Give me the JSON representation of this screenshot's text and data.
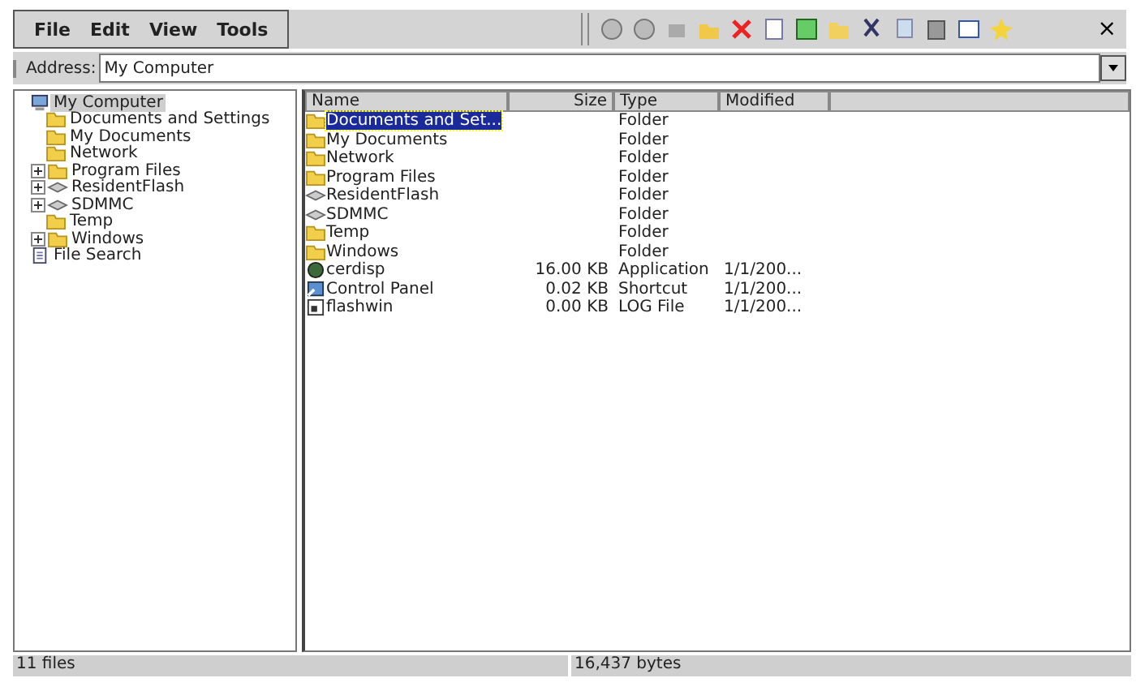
{
  "menu": [
    "File",
    "Edit",
    "View",
    "Tools"
  ],
  "close": "×",
  "address": {
    "label": "Address:",
    "value": "My Computer"
  },
  "tree": [
    {
      "label": "My Computer",
      "kind": "computer",
      "selected": true,
      "children": [
        {
          "label": "Documents and Settings",
          "kind": "folder",
          "selected": false
        },
        {
          "label": "My Documents",
          "kind": "folder",
          "selected": false
        },
        {
          "label": "Network",
          "kind": "folder",
          "selected": false
        },
        {
          "label": "Program Files",
          "kind": "folder",
          "selected": false,
          "expanded": false
        },
        {
          "label": "ResidentFlash",
          "kind": "drive",
          "selected": false,
          "expanded": false
        },
        {
          "label": "SDMMC",
          "kind": "drive",
          "selected": false,
          "expanded": false
        },
        {
          "label": "Temp",
          "kind": "folder",
          "selected": false
        },
        {
          "label": "Windows",
          "kind": "folder",
          "selected": false,
          "expanded": false
        }
      ]
    },
    {
      "label": "File Search",
      "kind": "search",
      "selected": false
    }
  ],
  "table": {
    "columns": [
      "Name",
      "Size",
      "Type",
      "Modified"
    ],
    "rows": [
      {
        "name": "Documents and Set...",
        "kind": "folder",
        "type": "Folder",
        "selected": true
      },
      {
        "name": "My Documents",
        "kind": "folder",
        "type": "Folder",
        "selected": false
      },
      {
        "name": "Network",
        "kind": "folder",
        "type": "Folder",
        "selected": false
      },
      {
        "name": "Program Files",
        "kind": "folder",
        "type": "Folder",
        "selected": false
      },
      {
        "name": "ResidentFlash",
        "kind": "drive",
        "type": "Folder",
        "selected": false
      },
      {
        "name": "SDMMC",
        "kind": "drive",
        "type": "Folder",
        "selected": false
      },
      {
        "name": "Temp",
        "kind": "folder",
        "type": "Folder",
        "selected": false
      },
      {
        "name": "Windows",
        "kind": "folder",
        "type": "Folder",
        "selected": false
      },
      {
        "name": "cerdisp",
        "kind": "app",
        "size": "16.00 KB",
        "type": "Application",
        "modified": "1/1/200...",
        "selected": false
      },
      {
        "name": "Control Panel",
        "kind": "shortcut",
        "size": "0.02 KB",
        "type": "Shortcut",
        "modified": "1/1/200...",
        "selected": false
      },
      {
        "name": "flashwin",
        "kind": "file",
        "size": "0.00 KB",
        "type": "LOG File",
        "modified": "1/1/200...",
        "selected": false
      }
    ]
  },
  "status_bar": [
    "11 files",
    "16,437 bytes"
  ]
}
